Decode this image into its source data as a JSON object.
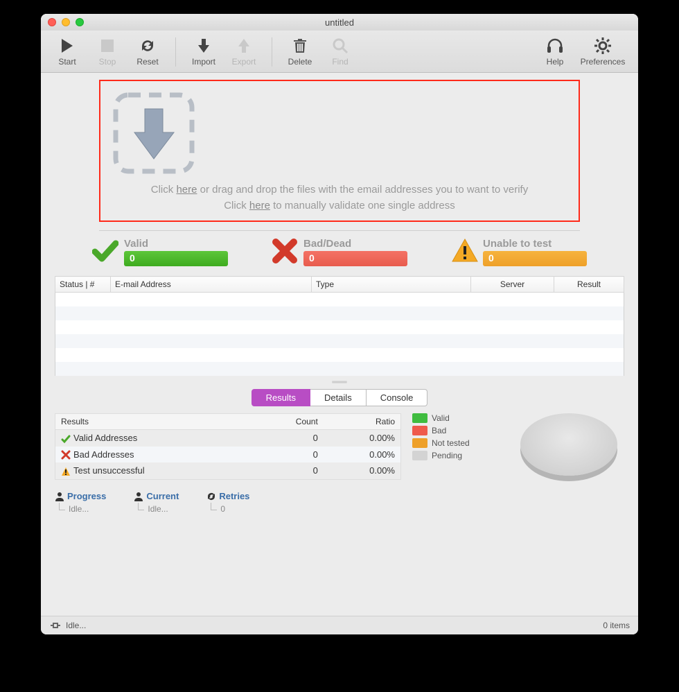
{
  "window": {
    "title": "untitled"
  },
  "toolbar": {
    "start": "Start",
    "stop": "Stop",
    "reset": "Reset",
    "import": "Import",
    "export": "Export",
    "delete": "Delete",
    "find": "Find",
    "help": "Help",
    "preferences": "Preferences"
  },
  "dropzone": {
    "line1_pre": "Click ",
    "link1": "here",
    "line1_post": " or drag and drop the files with the email addresses you to want to verify",
    "line2_pre": "Click ",
    "link2": "here",
    "line2_post": " to manually validate one single address"
  },
  "counters": {
    "valid": {
      "label": "Valid",
      "value": "0"
    },
    "bad": {
      "label": "Bad/Dead",
      "value": "0"
    },
    "unable": {
      "label": "Unable to test",
      "value": "0"
    }
  },
  "table": {
    "headers": {
      "status": "Status | #",
      "email": "E-mail Address",
      "type": "Type",
      "server": "Server",
      "result": "Result"
    }
  },
  "tabs": {
    "results": "Results",
    "details": "Details",
    "console": "Console"
  },
  "results_table": {
    "headers": {
      "results": "Results",
      "count": "Count",
      "ratio": "Ratio"
    },
    "rows": [
      {
        "label": "Valid Addresses",
        "count": "0",
        "ratio": "0.00%"
      },
      {
        "label": "Bad Addresses",
        "count": "0",
        "ratio": "0.00%"
      },
      {
        "label": "Test unsuccessful",
        "count": "0",
        "ratio": "0.00%"
      }
    ]
  },
  "legend": {
    "valid": "Valid",
    "bad": "Bad",
    "nottested": "Not tested",
    "pending": "Pending"
  },
  "status": {
    "progress": {
      "label": "Progress",
      "value": "Idle..."
    },
    "current": {
      "label": "Current",
      "value": "Idle..."
    },
    "retries": {
      "label": "Retries",
      "value": "0"
    }
  },
  "footer": {
    "status": "Idle...",
    "items": "0 items"
  }
}
